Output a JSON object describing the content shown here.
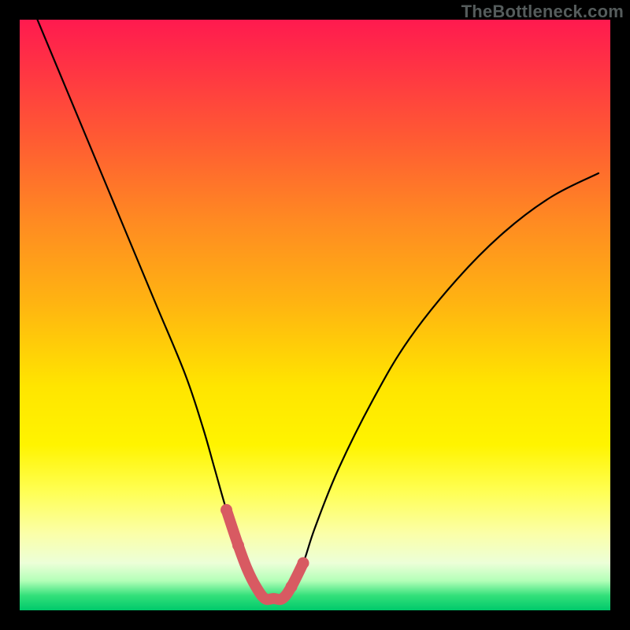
{
  "watermark": "TheBottleneck.com",
  "colors": {
    "frame": "#000000",
    "curve": "#000000",
    "valley_marker": "#d85a62",
    "gradient_top": "#ff1a4f",
    "gradient_bottom": "#00c96b"
  },
  "chart_data": {
    "type": "line",
    "title": "",
    "xlabel": "",
    "ylabel": "",
    "xlim": [
      0,
      100
    ],
    "ylim": [
      0,
      100
    ],
    "annotations": [],
    "series": [
      {
        "name": "bottleneck-curve",
        "x": [
          3,
          8,
          13,
          18,
          23,
          28,
          31,
          33,
          35,
          37,
          38.5,
          40,
          41.5,
          43,
          44.5,
          46,
          48,
          50,
          54,
          60,
          66,
          74,
          82,
          90,
          98
        ],
        "y": [
          100,
          88,
          76,
          64,
          52,
          40,
          31,
          24,
          17,
          11,
          7,
          4,
          2,
          2,
          2,
          4,
          8,
          14,
          24,
          36,
          46,
          56,
          64,
          70,
          74
        ]
      }
    ],
    "valley_marker": {
      "note": "thick pink U-shaped highlight at curve minimum",
      "x": [
        35,
        37,
        38.5,
        40,
        41.5,
        43,
        44.5,
        46,
        48
      ],
      "y": [
        17,
        11,
        7,
        4,
        2,
        2,
        2,
        4,
        8
      ]
    }
  }
}
